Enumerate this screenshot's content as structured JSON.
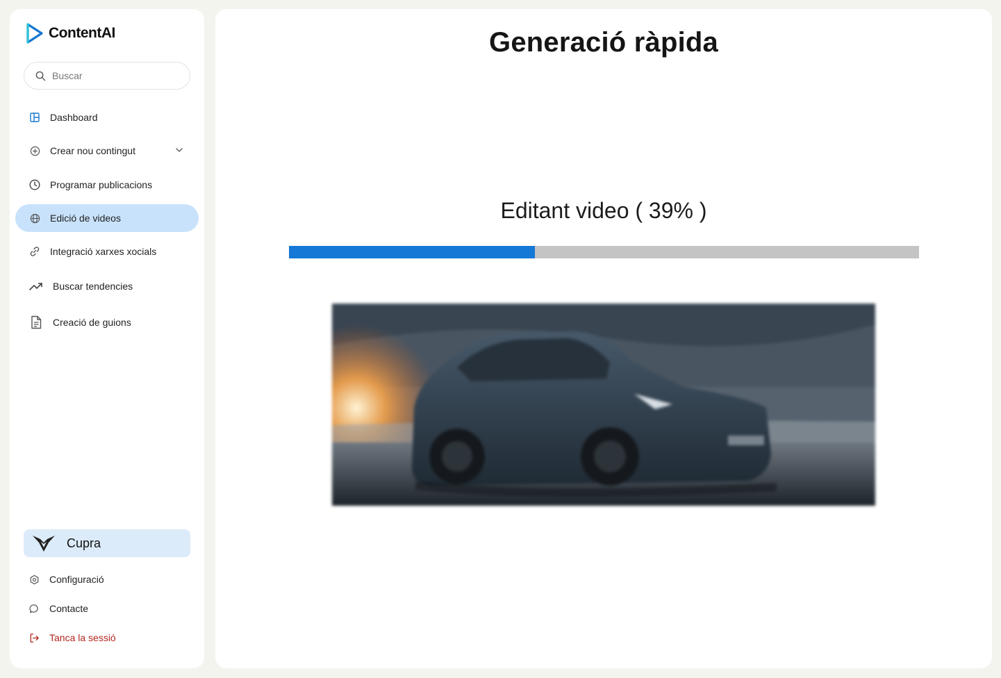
{
  "app": {
    "name": "ContentAI"
  },
  "search": {
    "placeholder": "Buscar"
  },
  "sidebar": {
    "items": [
      {
        "label": "Dashboard",
        "icon": "dashboard-icon"
      },
      {
        "label": "Crear nou contingut",
        "icon": "plus-circle-icon",
        "expandable": true
      },
      {
        "label": "Programar publicacions",
        "icon": "clock-icon"
      },
      {
        "label": "Edició de videos",
        "icon": "globe-icon",
        "active": true
      },
      {
        "label": "Integració xarxes xocials",
        "icon": "link-icon"
      },
      {
        "label": "Buscar tendencies",
        "icon": "trending-up-icon"
      },
      {
        "label": "Creació de guions",
        "icon": "document-icon"
      }
    ],
    "brand": {
      "name": "Cupra",
      "icon": "cupra-logo-icon"
    },
    "bottom": [
      {
        "label": "Configuració",
        "icon": "settings-icon"
      },
      {
        "label": "Contacte",
        "icon": "chat-icon"
      },
      {
        "label": "Tanca la sessió",
        "icon": "logout-icon"
      }
    ]
  },
  "main": {
    "title": "Generació ràpida",
    "progress": {
      "label": "Editant video ( 39% )",
      "percent": 39
    },
    "preview": {
      "icon": "video-preview-image"
    }
  },
  "colors": {
    "accent": "#1578d6",
    "active_bg": "#c9e2fb",
    "brand_bg": "#dcebf9",
    "logout": "#b3261e",
    "track": "#c4c4c4"
  }
}
